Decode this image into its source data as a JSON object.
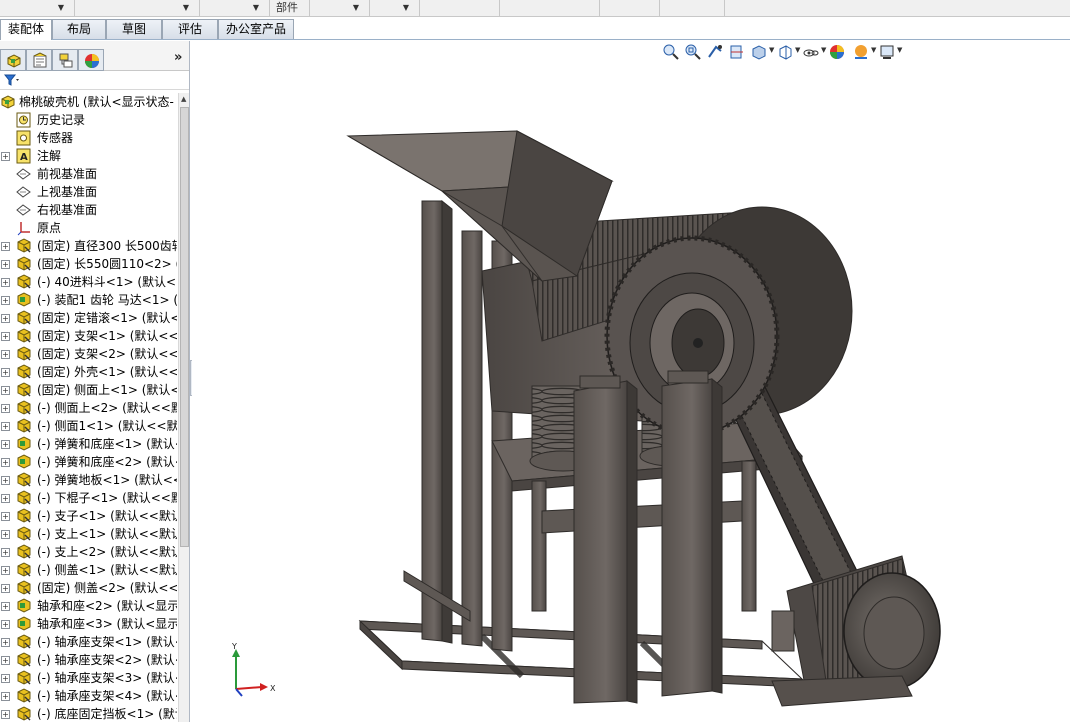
{
  "toolbar": {
    "top_fields": [
      "",
      "",
      "",
      "",
      "部件",
      "",
      "",
      "",
      "",
      "",
      ""
    ]
  },
  "command_tabs": [
    {
      "label": "装配体",
      "active": true
    },
    {
      "label": "布局",
      "active": false
    },
    {
      "label": "草图",
      "active": false
    },
    {
      "label": "评估",
      "active": false
    },
    {
      "label": "办公室产品",
      "active": false
    }
  ],
  "panel": {
    "tab_icons": [
      "feature-manager-icon",
      "property-manager-icon",
      "configuration-manager-icon",
      "appearance-icon"
    ],
    "expand_glyph": "»",
    "filter_glyph": "▼"
  },
  "tree": {
    "root_label": "棉桃破壳机 (默认<显示状态-",
    "items": [
      {
        "label": "历史记录",
        "icon": "history-icon",
        "expandable": false
      },
      {
        "label": "传感器",
        "icon": "sensor-icon",
        "expandable": false
      },
      {
        "label": "注解",
        "icon": "annotation-icon",
        "expandable": true
      },
      {
        "label": "前视基准面",
        "icon": "plane-icon",
        "expandable": false
      },
      {
        "label": "上视基准面",
        "icon": "plane-icon",
        "expandable": false
      },
      {
        "label": "右视基准面",
        "icon": "plane-icon",
        "expandable": false
      },
      {
        "label": "原点",
        "icon": "origin-icon",
        "expandable": false
      },
      {
        "label": "(固定) 直径300  长500齿轴",
        "icon": "part-icon",
        "expandable": true
      },
      {
        "label": "(固定) 长550圆110<2> (默",
        "icon": "part-icon",
        "expandable": true
      },
      {
        "label": "(-) 40进料斗<1> (默认<<默",
        "icon": "part-icon",
        "expandable": true
      },
      {
        "label": "(-) 装配1 齿轮 马达<1> (默",
        "icon": "subassembly-icon",
        "expandable": true
      },
      {
        "label": "(固定) 定错滚<1> (默认<<默",
        "icon": "part-icon",
        "expandable": true
      },
      {
        "label": "(固定) 支架<1> (默认<<默",
        "icon": "part-icon",
        "expandable": true
      },
      {
        "label": "(固定) 支架<2> (默认<<默",
        "icon": "part-icon",
        "expandable": true
      },
      {
        "label": "(固定) 外壳<1> (默认<<默",
        "icon": "part-icon",
        "expandable": true
      },
      {
        "label": "(固定) 侧面上<1> (默认<",
        "icon": "part-icon",
        "expandable": true
      },
      {
        "label": "(-) 侧面上<2> (默认<<默认",
        "icon": "part-icon",
        "expandable": true
      },
      {
        "label": "(-) 侧面1<1> (默认<<默认",
        "icon": "part-icon",
        "expandable": true
      },
      {
        "label": "(-) 弹簧和底座<1> (默认<",
        "icon": "subassembly-icon",
        "expandable": true
      },
      {
        "label": "(-) 弹簧和底座<2> (默认<",
        "icon": "subassembly-icon",
        "expandable": true
      },
      {
        "label": "(-) 弹簧地板<1> (默认<<",
        "icon": "part-icon",
        "expandable": true
      },
      {
        "label": "(-) 下棍子<1> (默认<<默",
        "icon": "part-icon",
        "expandable": true
      },
      {
        "label": "(-) 支子<1> (默认<<默认",
        "icon": "part-icon",
        "expandable": true
      },
      {
        "label": "(-) 支上<1> (默认<<默认",
        "icon": "part-icon",
        "expandable": true
      },
      {
        "label": "(-) 支上<2> (默认<<默认",
        "icon": "part-icon",
        "expandable": true
      },
      {
        "label": "(-) 侧盖<1> (默认<<默认",
        "icon": "part-icon",
        "expandable": true
      },
      {
        "label": "(固定) 侧盖<2> (默认<<默",
        "icon": "part-icon",
        "expandable": true
      },
      {
        "label": "轴承和座<2> (默认<显示",
        "icon": "subassembly-icon",
        "expandable": true
      },
      {
        "label": "轴承和座<3> (默认<显示",
        "icon": "subassembly-icon",
        "expandable": true
      },
      {
        "label": "(-) 轴承座支架<1> (默认<",
        "icon": "part-icon",
        "expandable": true
      },
      {
        "label": "(-) 轴承座支架<2> (默认<",
        "icon": "part-icon",
        "expandable": true
      },
      {
        "label": "(-) 轴承座支架<3> (默认<",
        "icon": "part-icon",
        "expandable": true
      },
      {
        "label": "(-) 轴承座支架<4> (默认<",
        "icon": "part-icon",
        "expandable": true
      },
      {
        "label": "(-) 底座固定挡板<1> (默认",
        "icon": "part-icon",
        "expandable": true
      }
    ]
  },
  "heads_up_toolbar": [
    "zoom-to-fit-icon",
    "zoom-to-area-icon",
    "previous-view-icon",
    "section-view-icon",
    "view-orientation-icon",
    "display-style-icon",
    "hide-show-items-icon",
    "edit-appearance-icon",
    "apply-scene-icon",
    "view-settings-icon"
  ],
  "triad": {
    "x_label": "X",
    "y_label": "Y"
  },
  "colors": {
    "accent": "#2a5fa8",
    "model": "#5e5854",
    "model_dark": "#3a3634",
    "model_light": "#7a736e",
    "part_icon": "#e8c020"
  }
}
